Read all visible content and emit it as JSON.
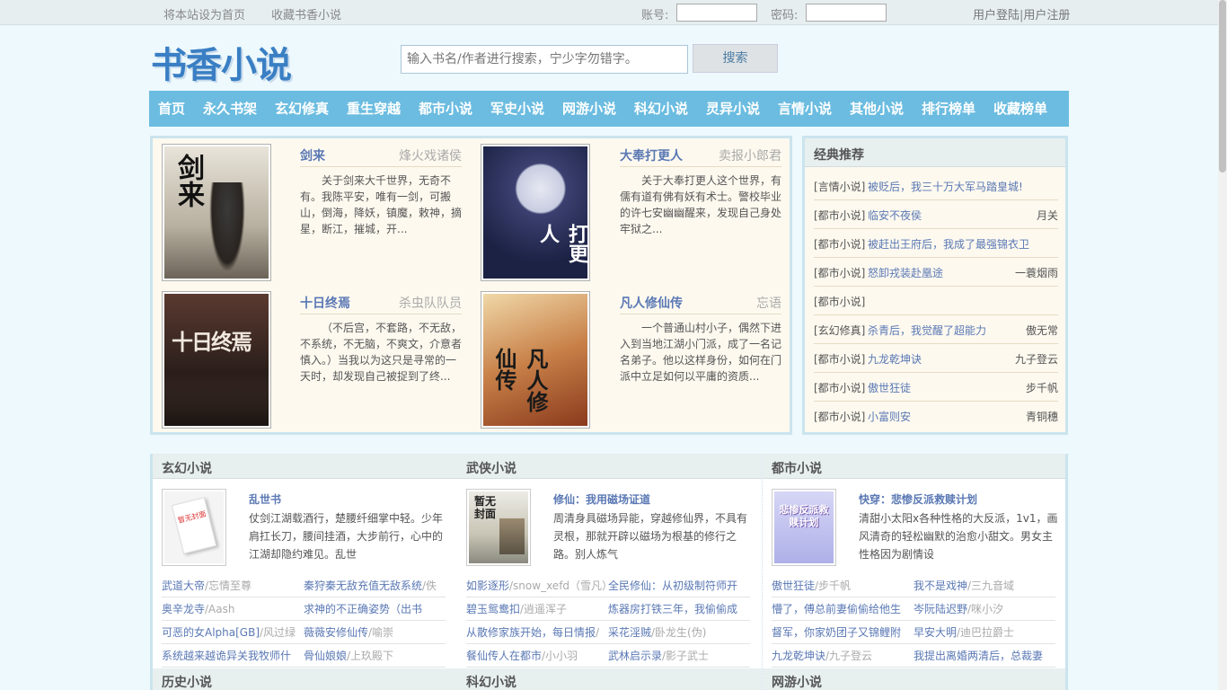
{
  "topbar": {
    "set_home": "将本站设为首页",
    "bookmark": "收藏书香小说",
    "account_label": "账号:",
    "password_label": "密码:",
    "login": "用户登陆",
    "separator": "|",
    "register": "用户注册"
  },
  "header": {
    "logo": "书香小说",
    "search_placeholder": "输入书名/作者进行搜索，宁少字勿错字。",
    "search_button": "搜索"
  },
  "nav": [
    "首页",
    "永久书架",
    "玄幻修真",
    "重生穿越",
    "都市小说",
    "军史小说",
    "网游小说",
    "科幻小说",
    "灵异小说",
    "言情小说",
    "其他小说",
    "排行榜单",
    "收藏榜单"
  ],
  "featured": [
    {
      "title": "剑来",
      "author": "烽火戏诸侯",
      "desc": "关于剑来大千世界，无奇不有。我陈平安，唯有一剑，可搬山，倒海，降妖，镇魔，敕神，摘星，断江，摧城，开...",
      "cover_text": "剑来",
      "cover_color": "#d8d2c4"
    },
    {
      "title": "大奉打更人",
      "author": "卖报小郎君",
      "desc": "关于大奉打更人这个世界，有儒有道有佛有妖有术士。警校毕业的许七安幽幽醒来，发现自己身处牢狱之...",
      "cover_text": "打更人",
      "cover_color": "#2a2f55"
    },
    {
      "title": "十日终焉",
      "author": "杀虫队队员",
      "desc": "（不后宫，不套路，不无敌，不系统，不无脑，不爽文，介意者慎入。）当我以为这只是寻常的一天时，却发现自己被捉到了终...",
      "cover_text": "十日终焉",
      "cover_color": "#3a2a24"
    },
    {
      "title": "凡人修仙传",
      "author": "忘语",
      "desc": "一个普通山村小子，偶然下进入到当地江湖小门派，成了一名记名弟子。他以这样身份，如何在门派中立足如何以平庸的资质...",
      "cover_text": "凡人修仙传",
      "cover_color": "#c9a26a"
    }
  ],
  "classic": {
    "title": "经典推荐",
    "items": [
      {
        "cat": "[言情小说]",
        "book": "被贬后，我三十万大军马踏皇城!",
        "author": ""
      },
      {
        "cat": "[都市小说]",
        "book": "临安不夜侯",
        "author": "月关"
      },
      {
        "cat": "[都市小说]",
        "book": "被赶出王府后，我成了最强锦衣卫",
        "author": ""
      },
      {
        "cat": "[都市小说]",
        "book": "怒卸戎装赴凰途",
        "author": "一蓑烟雨"
      },
      {
        "cat": "[都市小说]",
        "book": "",
        "author": ""
      },
      {
        "cat": "[玄幻修真]",
        "book": "杀青后，我觉醒了超能力",
        "author": "傲无常"
      },
      {
        "cat": "[都市小说]",
        "book": "九龙乾坤诀",
        "author": "九子登云"
      },
      {
        "cat": "[都市小说]",
        "book": "傲世狂徒",
        "author": "步千帆"
      },
      {
        "cat": "[都市小说]",
        "book": "小富则安",
        "author": "青铜穗"
      }
    ]
  },
  "panels": [
    {
      "title": "玄幻小说",
      "book": {
        "title": "乱世书",
        "desc": "仗剑江湖载酒行，楚腰纤细掌中轻。少年肩扛长刀，腰间挂酒，大步前行，心中的江湖却隐约难见。乱世",
        "cover_text": "暂无封面",
        "cover_color": "#f2f2f2"
      },
      "links": [
        {
          "name": "武道大帝",
          "author": "/忘情至尊"
        },
        {
          "name": "秦狩秦无敌充值无敌系统",
          "author": "/佚"
        },
        {
          "name": "奥辛龙寺",
          "author": "/Aash"
        },
        {
          "name": "求神的不正确姿势（出书",
          "author": ""
        },
        {
          "name": "可恶的女Alpha[GB]",
          "author": "/风过绿"
        },
        {
          "name": "薇薇安修仙传",
          "author": "/喻崇"
        },
        {
          "name": "系统越来越诡异关我牧师什",
          "author": ""
        },
        {
          "name": "骨仙娘娘",
          "author": "/上玖殿下"
        }
      ],
      "next_title": "历史小说"
    },
    {
      "title": "武侠小说",
      "book": {
        "title": "修仙：我用磁场证道",
        "desc": "周清身具磁场异能，穿越修仙界，不具有灵根，那就开辟以磁场为根基的修行之路。别人炼气",
        "cover_text": "暂无封面",
        "cover_color": "#e9e4d6"
      },
      "links": [
        {
          "name": "如影逐形",
          "author": "/snow_xefd（雪凡）"
        },
        {
          "name": "全民修仙：从初级制符师开",
          "author": ""
        },
        {
          "name": "碧玉鸳鸯扣",
          "author": "/逍遥浑子"
        },
        {
          "name": "炼器房打铁三年，我偷偷成",
          "author": ""
        },
        {
          "name": "从散修家族开始，每日情报",
          "author": "/"
        },
        {
          "name": "采花淫贼",
          "author": "/卧龙生(伪)"
        },
        {
          "name": "餐仙传人在都市",
          "author": "/小小羽"
        },
        {
          "name": "武林启示录",
          "author": "/影子武士"
        }
      ],
      "next_title": "科幻小说"
    },
    {
      "title": "都市小说",
      "book": {
        "title": "快穿：悲惨反派救赎计划",
        "desc": "清甜小太阳x各种性格的大反派，1v1，画风清奇的轻松幽默的治愈小甜文。男女主性格因为剧情设",
        "cover_text": "悲惨反派救赎计划",
        "cover_color": "#bfc0ee"
      },
      "links": [
        {
          "name": "傲世狂徒",
          "author": "/步千帆"
        },
        {
          "name": "我不是戏神",
          "author": "/三九音域"
        },
        {
          "name": "懵了，傅总前妻偷偷给他生",
          "author": ""
        },
        {
          "name": "岑阮陆迟野",
          "author": "/咪小汐"
        },
        {
          "name": "督军，你家奶团子又锦鲤附",
          "author": ""
        },
        {
          "name": "早安大明",
          "author": "/迪巴拉爵士"
        },
        {
          "name": "九龙乾坤诀",
          "author": "/九子登云"
        },
        {
          "name": "我提出离婚两清后，总裁妻",
          "author": ""
        }
      ],
      "next_title": "网游小说"
    }
  ],
  "colors": {
    "accent": "#6bbce0",
    "link": "#5a78b4",
    "panel_bg": "#fdf9ef",
    "border": "#cbe4ee"
  }
}
